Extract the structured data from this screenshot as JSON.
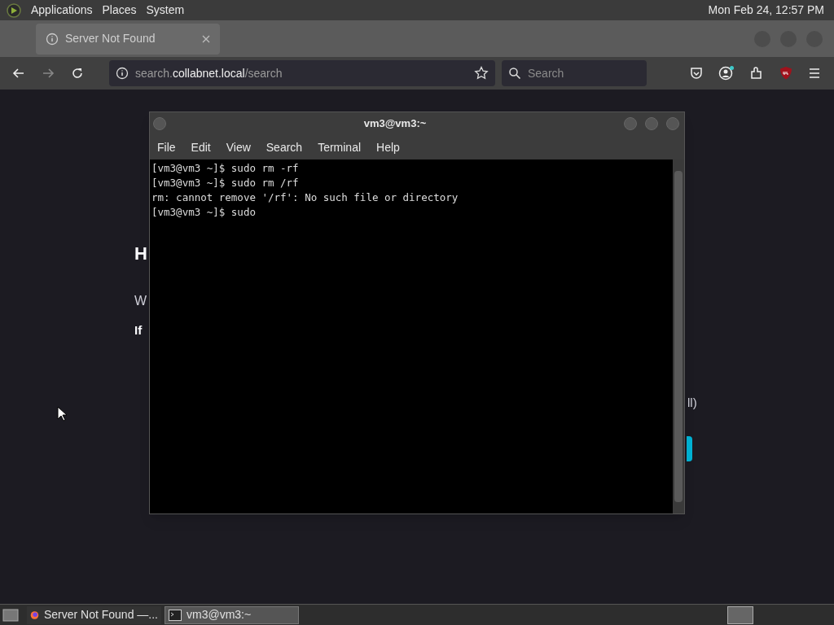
{
  "top_panel": {
    "menus": [
      "Applications",
      "Places",
      "System"
    ],
    "clock": "Mon Feb 24, 12:57 PM"
  },
  "browser": {
    "tab": {
      "title": "Server Not Found",
      "selected": true
    },
    "url": {
      "prefix": "search.",
      "host": "collabnet.local",
      "path": "/search"
    },
    "search": {
      "placeholder": "Search"
    },
    "page": {
      "heading": "H",
      "line_1": "W",
      "line_2": "If",
      "line_3": "ll)"
    }
  },
  "terminal": {
    "title": "vm3@vm3:~",
    "menus": [
      "File",
      "Edit",
      "View",
      "Search",
      "Terminal",
      "Help"
    ],
    "lines": [
      "[vm3@vm3 ~]$ sudo rm -rf",
      "[vm3@vm3 ~]$ sudo rm /rf",
      "rm: cannot remove '/rf': No such file or directory",
      "[vm3@vm3 ~]$ sudo"
    ]
  },
  "taskbar": {
    "items": [
      {
        "label": "Server Not Found —...",
        "kind": "browser",
        "selected": false
      },
      {
        "label": "vm3@vm3:~",
        "kind": "terminal",
        "selected": true
      }
    ]
  }
}
